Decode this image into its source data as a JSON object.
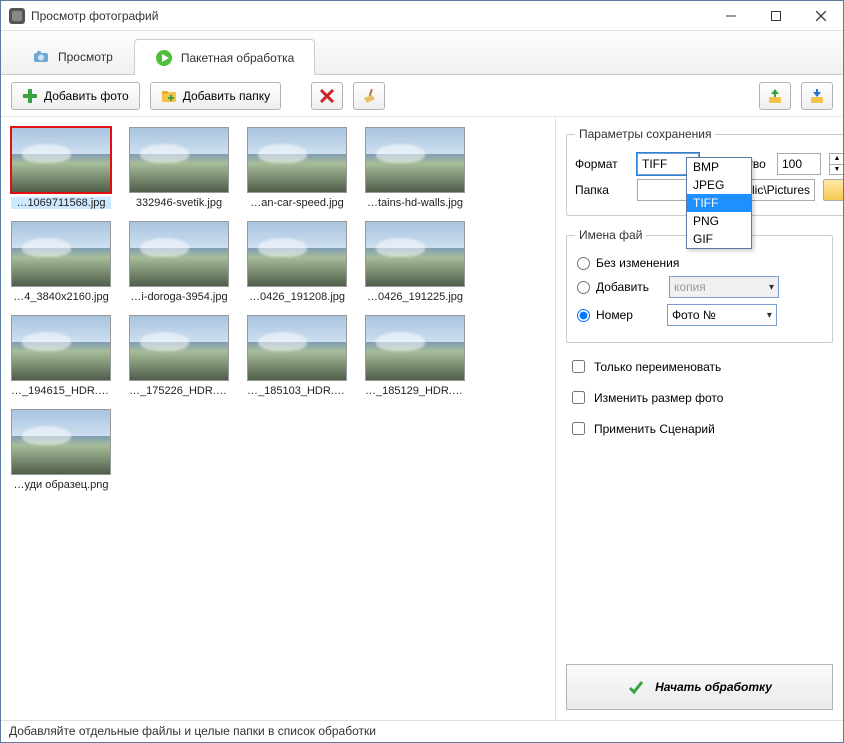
{
  "window": {
    "title": "Просмотр фотографий"
  },
  "tabs": {
    "view": "Просмотр",
    "batch": "Пакетная обработка"
  },
  "toolbar": {
    "add_photo": "Добавить фото",
    "add_folder": "Добавить папку"
  },
  "thumbs": [
    {
      "label": "…1069711568.jpg",
      "selected": true
    },
    {
      "label": "332946-svetik.jpg"
    },
    {
      "label": "…an-car-speed.jpg"
    },
    {
      "label": "…tains-hd-walls.jpg"
    },
    {
      "label": "…4_3840x2160.jpg"
    },
    {
      "label": "…i-doroga-3954.jpg"
    },
    {
      "label": "…0426_191208.jpg"
    },
    {
      "label": "…0426_191225.jpg"
    },
    {
      "label": "…_194615_HDR.jpg"
    },
    {
      "label": "…_175226_HDR.jpg"
    },
    {
      "label": "…_185103_HDR.jpg"
    },
    {
      "label": "…_185129_HDR.jpg"
    },
    {
      "label": "…уди образец.png"
    }
  ],
  "save": {
    "group": "Параметры сохранения",
    "format_label": "Формат",
    "format_value": "TIFF",
    "format_options": [
      "BMP",
      "JPEG",
      "TIFF",
      "PNG",
      "GIF"
    ],
    "quality_label": "Качество",
    "quality_value": "100",
    "folder_label": "Папка",
    "folder_value": "blic\\Pictures"
  },
  "names": {
    "group": "Имена фай",
    "no_change": "Без изменения",
    "add": "Добавить",
    "add_value": "копия",
    "number": "Номер",
    "number_value": "Фото №"
  },
  "options": {
    "rename_only": "Только переименовать",
    "resize": "Изменить размер фото",
    "apply_scenario": "Применить Сценарий"
  },
  "start": "Начать обработку",
  "status": "Добавляйте отдельные файлы и целые папки в список обработки"
}
